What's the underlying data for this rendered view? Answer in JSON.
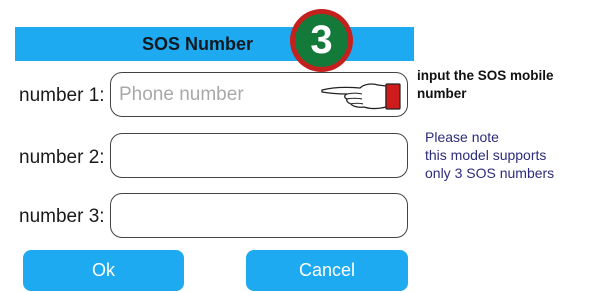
{
  "dialog": {
    "title": "SOS Number",
    "step_number": "3"
  },
  "fields": [
    {
      "label": "number 1:",
      "value": "",
      "placeholder": "Phone number"
    },
    {
      "label": "number 2:",
      "value": "",
      "placeholder": ""
    },
    {
      "label": "number 3:",
      "value": "",
      "placeholder": ""
    }
  ],
  "annotations": {
    "instruction": "input the SOS mobile number",
    "note_line1": "Please note",
    "note_line2": "this model supports",
    "note_line3": "only 3 SOS numbers"
  },
  "buttons": {
    "ok_label": "Ok",
    "cancel_label": "Cancel"
  },
  "colors": {
    "accent": "#1eaaf1",
    "badge_ring": "#c4211e",
    "badge_fill": "#137a3a",
    "note_text": "#2c2c7a"
  },
  "icons": {
    "pointer": "pointing-hand-icon"
  }
}
